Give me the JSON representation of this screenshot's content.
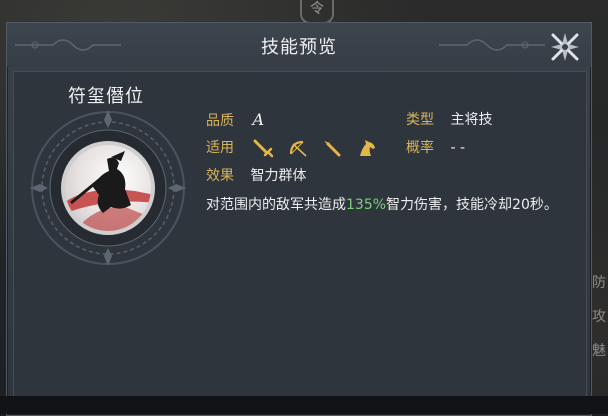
{
  "background": {
    "emblem_char": "令",
    "side_chars": [
      "防",
      "攻",
      "魅"
    ]
  },
  "dialog": {
    "title": "技能预览",
    "close_icon": "close-cross-icon"
  },
  "skill": {
    "name": "符玺僭位",
    "quality_label": "品质",
    "quality_value": "A",
    "type_label": "类型",
    "type_value": "主将技",
    "applies_label": "适用",
    "applies_icons": [
      "sword-icon",
      "bow-icon",
      "spear-icon",
      "horse-icon"
    ],
    "chance_label": "概率",
    "chance_value": "- -",
    "effect_label": "效果",
    "effect_value": "智力群体",
    "description_prefix": "对范围内的敌军共造成",
    "description_highlight": "135%",
    "description_suffix": "智力伤害，技能冷却20秒。"
  },
  "colors": {
    "label_gold": "#d7b45d",
    "highlight_green": "#7bd07a",
    "panel_bg": "#2f353c",
    "dialog_bg": "#3a4149"
  }
}
